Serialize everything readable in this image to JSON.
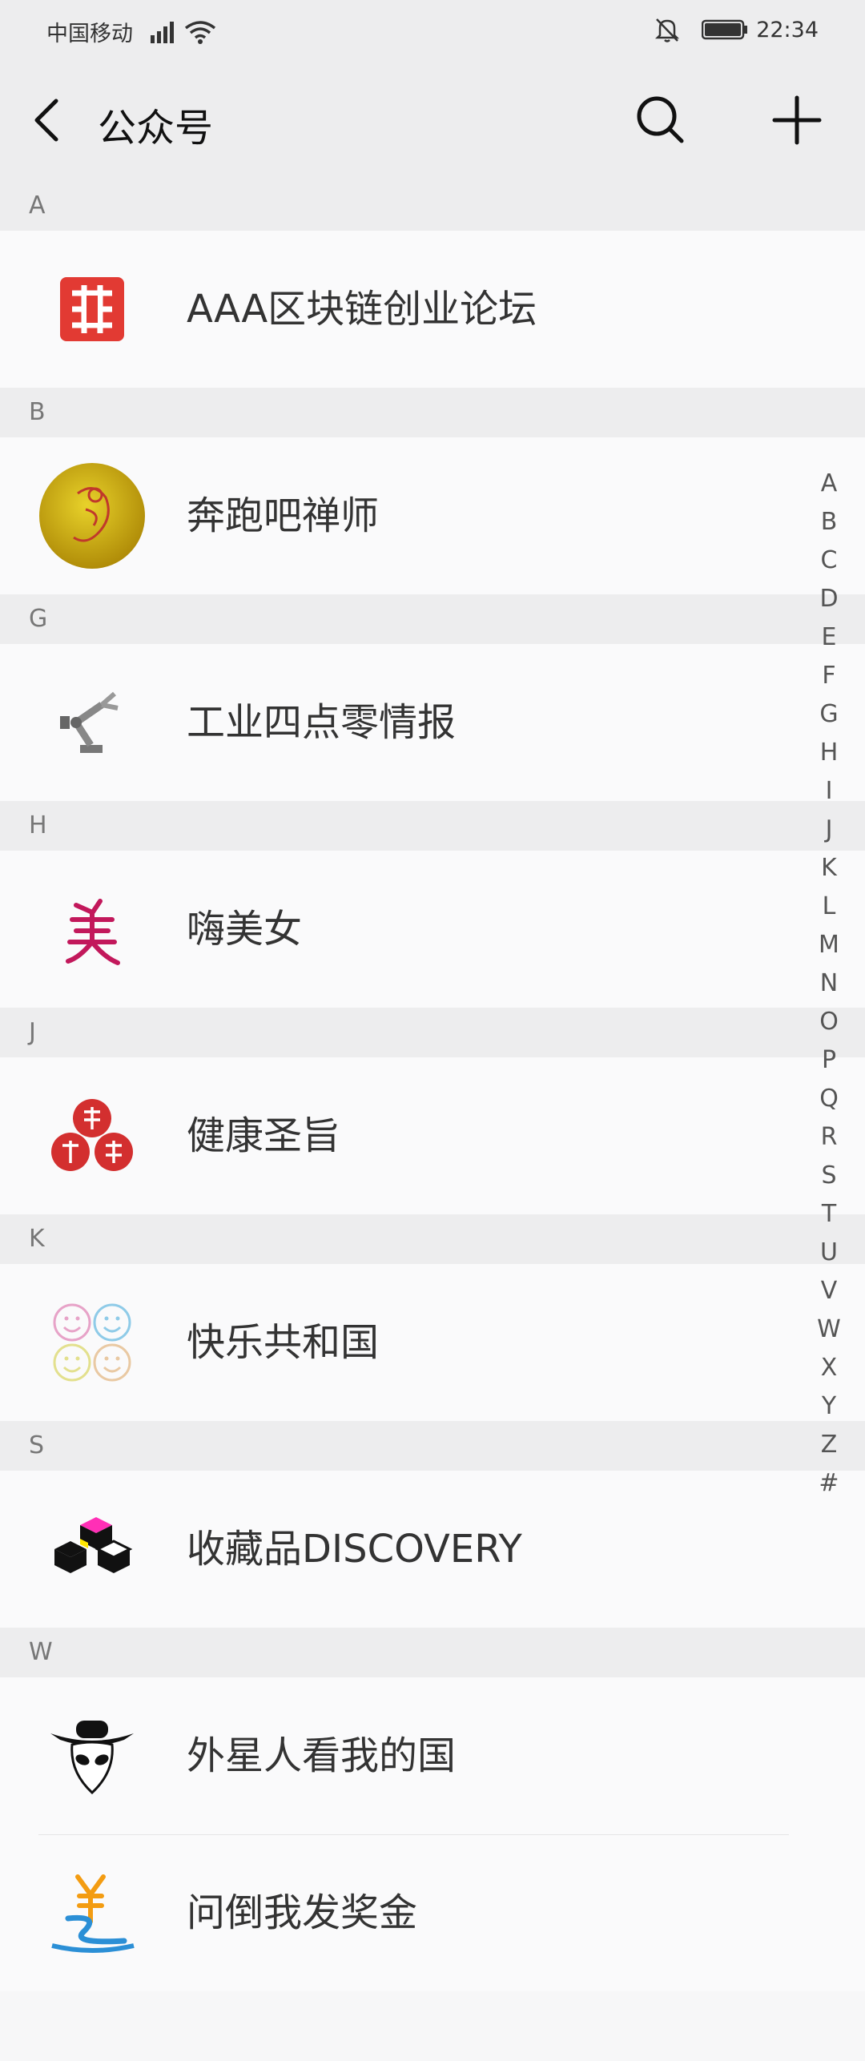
{
  "status_bar": {
    "carrier": "中国移动",
    "time": "22:34"
  },
  "header": {
    "title": "公众号",
    "icons": [
      "back-icon",
      "search-icon",
      "add-icon"
    ]
  },
  "sections": [
    {
      "letter": "A",
      "items": [
        {
          "name": "AAA区块链创业论坛",
          "icon": "red-knot-logo"
        }
      ]
    },
    {
      "letter": "B",
      "items": [
        {
          "name": "奔跑吧禅师",
          "icon": "gold-coin-logo"
        }
      ]
    },
    {
      "letter": "G",
      "items": [
        {
          "name": "工业四点零情报",
          "icon": "robot-arm-logo"
        }
      ]
    },
    {
      "letter": "H",
      "items": [
        {
          "name": "嗨美女",
          "icon": "mei-calligraphy-logo"
        }
      ]
    },
    {
      "letter": "J",
      "items": [
        {
          "name": "健康圣旨",
          "icon": "fu-seal-logo"
        }
      ]
    },
    {
      "letter": "K",
      "items": [
        {
          "name": "快乐共和国",
          "icon": "smiley-faces-logo"
        }
      ]
    },
    {
      "letter": "S",
      "items": [
        {
          "name": "收藏品DISCOVERY",
          "icon": "cubes-logo"
        }
      ]
    },
    {
      "letter": "W",
      "items": [
        {
          "name": "外星人看我的国",
          "icon": "alien-hat-logo"
        },
        {
          "name": "问倒我发奖金",
          "icon": "yuan-logo"
        }
      ]
    }
  ],
  "index_letters": [
    "A",
    "B",
    "C",
    "D",
    "E",
    "F",
    "G",
    "H",
    "I",
    "J",
    "K",
    "L",
    "M",
    "N",
    "O",
    "P",
    "Q",
    "R",
    "S",
    "T",
    "U",
    "V",
    "W",
    "X",
    "Y",
    "Z",
    "#"
  ],
  "colors": {
    "background": "#f7f7f8",
    "header_bg": "#ededee",
    "row_bg": "#fafafb",
    "section_text": "#777777",
    "red_logo": "#e23a33",
    "gold_logo": "#c9a70e"
  }
}
